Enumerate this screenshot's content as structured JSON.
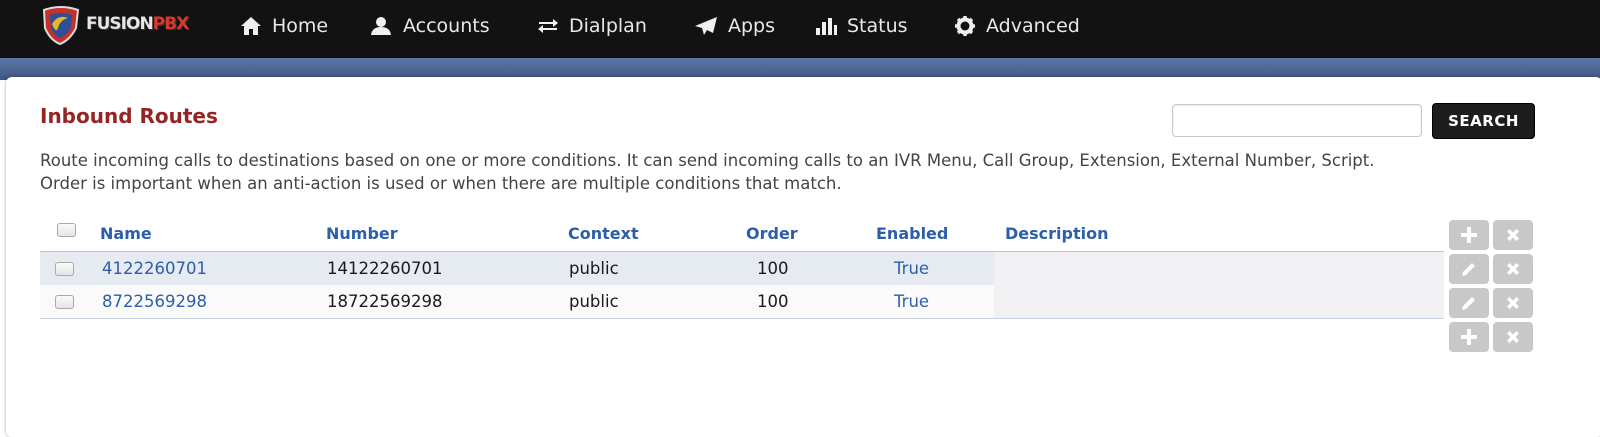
{
  "nav": {
    "brand": {
      "fusion": "FUSION",
      "pbx": "PBX"
    },
    "items": [
      {
        "label": "Home",
        "icon": "home-icon"
      },
      {
        "label": "Accounts",
        "icon": "user-icon"
      },
      {
        "label": "Dialplan",
        "icon": "transfer-arrows-icon"
      },
      {
        "label": "Apps",
        "icon": "send-icon"
      },
      {
        "label": "Status",
        "icon": "bar-chart-icon"
      },
      {
        "label": "Advanced",
        "icon": "gear-icon"
      }
    ]
  },
  "page": {
    "title": "Inbound Routes",
    "description_line1": "Route incoming calls to destinations based on one or more conditions. It can send incoming calls to an IVR Menu, Call Group, Extension, External Number, Script.",
    "description_line2": "Order is important when an anti-action is used or when there are multiple conditions that match."
  },
  "search": {
    "value": "",
    "button_label": "SEARCH"
  },
  "table": {
    "columns": [
      "Name",
      "Number",
      "Context",
      "Order",
      "Enabled",
      "Description"
    ],
    "rows": [
      {
        "name": "4122260701",
        "number": "14122260701",
        "context": "public",
        "order": "100",
        "enabled": "True",
        "description": ""
      },
      {
        "name": "8722569298",
        "number": "18722569298",
        "context": "public",
        "order": "100",
        "enabled": "True",
        "description": ""
      }
    ]
  },
  "colors": {
    "navbar": "#121212",
    "title": "#952424",
    "link": "#2d5fa8",
    "action_button": "#c8c8c8"
  }
}
